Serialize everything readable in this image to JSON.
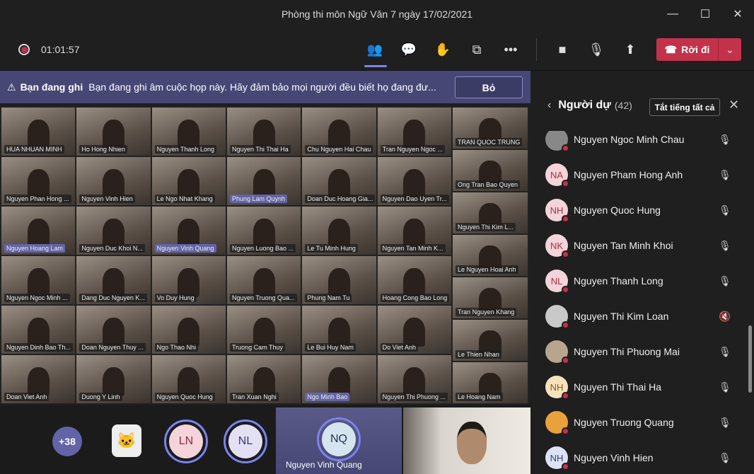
{
  "window": {
    "title": "Phòng thi môn Ngữ Văn 7 ngày 17/02/2021"
  },
  "toolbar": {
    "timer": "01:01:57",
    "leave_label": "Rời đi",
    "icons": [
      "people-icon",
      "chat-icon",
      "raise-hand-icon",
      "breakout-icon",
      "more-icon",
      "camera-icon",
      "mic-icon",
      "share-icon"
    ]
  },
  "banner": {
    "title": "Bạn đang ghi",
    "message": "Bạn đang ghi âm cuộc họp này. Hãy đảm bảo mọi người đều biết họ đang đư...",
    "dismiss": "Bỏ"
  },
  "shared_grid": [
    {
      "name": "HUA NHUAN MINH"
    },
    {
      "name": "Ho Hong Nhien"
    },
    {
      "name": "Nguyen Thanh Long"
    },
    {
      "name": "Nguyen Thi Thai Ha"
    },
    {
      "name": "Chu Nguyen Hai Chau"
    },
    {
      "name": "Tran Nguyen Ngoc ..."
    },
    {
      "name": "Nguyen Phan Hong ..."
    },
    {
      "name": "Nguyen Vinh Hien"
    },
    {
      "name": "Le Ngo Nhat Khang"
    },
    {
      "name": "Phung Lam Quynh",
      "highlight": true
    },
    {
      "name": "Doan Duc Hoang Gia..."
    },
    {
      "name": "Nguyen Dao Uyen Tr..."
    },
    {
      "name": "Nguyen Hoang Lam",
      "highlight": true
    },
    {
      "name": "Nguyen Duc Khoi N..."
    },
    {
      "name": "Nguyen Vinh Quang",
      "highlight": true
    },
    {
      "name": "Nguyen Luong Bao ..."
    },
    {
      "name": "Le Tu Minh Hung"
    },
    {
      "name": "Nguyen Tan Minh K..."
    },
    {
      "name": "Nguyen Ngoc Minh ..."
    },
    {
      "name": "Dang Duc Nguyen K..."
    },
    {
      "name": "Vo Duy Hung"
    },
    {
      "name": "Nguyen Truong Qua..."
    },
    {
      "name": "Phung Nam Tu"
    },
    {
      "name": "Hoang Cong Bao Long"
    },
    {
      "name": "Nguyen Dinh Bao Th..."
    },
    {
      "name": "Doan Nguyen Thuy ..."
    },
    {
      "name": "Ngo Thao Nhi"
    },
    {
      "name": "Truong Cam Thuy"
    },
    {
      "name": "Le Bui Huy Nam"
    },
    {
      "name": "Do Viet Anh"
    },
    {
      "name": "Doan Viet Anh"
    },
    {
      "name": "Duong Y Linh"
    },
    {
      "name": "Nguyen Quoc Hung"
    },
    {
      "name": "Tran Xuan Nghi"
    },
    {
      "name": "Ngo Minh Bao",
      "highlight": true
    },
    {
      "name": "Nguyen Thi Phuong ..."
    }
  ],
  "shared_side_column": [
    {
      "name": "TRAN QUOC TRUNG"
    },
    {
      "name": "Ong Tran Bao Quyen"
    },
    {
      "name": "Nguyen Thi Kim L..."
    },
    {
      "name": "Le Nguyen Hoai Anh"
    },
    {
      "name": "Tran Nguyen Khang"
    },
    {
      "name": "Le Thien Nhan"
    },
    {
      "name": "Le Hoang Nam"
    }
  ],
  "stage": {
    "overflow": "+38",
    "tiles": [
      {
        "initials": "LN",
        "bg": "#f4d3da",
        "fg": "#8a2b44"
      },
      {
        "initials": "NL",
        "bg": "#e2e0f2",
        "fg": "#3b3a6b"
      }
    ],
    "active_speaker": {
      "initials": "NQ",
      "name": "Nguyen Vinh Quang"
    }
  },
  "panel": {
    "title": "Người dự",
    "count": "(42)",
    "mute_all": "Tắt tiếng tất cả",
    "participants": [
      {
        "name": "Nguyen Ngoc Minh Chau",
        "initials": "",
        "bg": "#888",
        "muted": false
      },
      {
        "name": "Nguyen Pham Hong Anh",
        "initials": "NA",
        "bg": "#f4d3da",
        "fg": "#a33245",
        "muted": false
      },
      {
        "name": "Nguyen Quoc Hung",
        "initials": "NH",
        "bg": "#f4d3da",
        "fg": "#a33245",
        "muted": false
      },
      {
        "name": "Nguyen Tan Minh Khoi",
        "initials": "NK",
        "bg": "#f4d3da",
        "fg": "#a33245",
        "muted": false
      },
      {
        "name": "Nguyen Thanh Long",
        "initials": "NL",
        "bg": "#f4d3da",
        "fg": "#a33245",
        "muted": false
      },
      {
        "name": "Nguyen Thi Kim Loan",
        "initials": "",
        "bg": "#c9c9c9",
        "muted": true
      },
      {
        "name": "Nguyen Thi Phuong Mai",
        "initials": "",
        "bg": "#b9a48e",
        "muted": false
      },
      {
        "name": "Nguyen Thi Thai Ha",
        "initials": "NH",
        "bg": "#f6e3bd",
        "fg": "#8a5a12",
        "muted": false
      },
      {
        "name": "Nguyen Truong Quang",
        "initials": "",
        "bg": "#e9a23b",
        "muted": false
      },
      {
        "name": "Nguyen Vinh Hien",
        "initials": "NH",
        "bg": "#dde3f5",
        "fg": "#2f3d7a",
        "muted": false
      }
    ]
  }
}
